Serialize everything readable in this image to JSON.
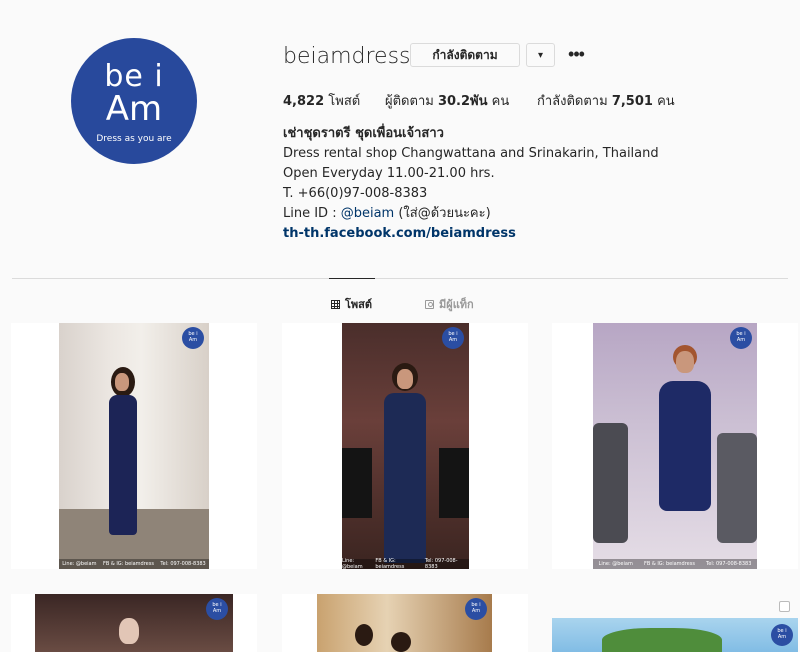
{
  "profile": {
    "avatar": {
      "line1": "be i",
      "line2": "Am",
      "tagline": "Dress as you are"
    },
    "username": "beiamdress",
    "follow_label": "กำลังติดตาม",
    "dropdown_icon": "▾",
    "more_icon": "•••",
    "stats": {
      "posts_value": "4,822",
      "posts_label": "โพสต์",
      "followers_label": "ผู้ติดตาม",
      "followers_value": "30.2พัน",
      "followers_unit": "คน",
      "following_label": "กำลังติดตาม",
      "following_value": "7,501",
      "following_unit": "คน"
    },
    "bio": {
      "name": "เช่าชุดราตรี ชุดเพื่อนเจ้าสาว",
      "line1": "Dress rental shop Changwattana and Srinakarin, Thailand",
      "line2": "Open Everyday 11.00-21.00 hrs.",
      "line3": "T. +66(0)97-008-8383",
      "line_prefix": "Line ID : ",
      "line_mention": "@beiam",
      "line_suffix": " (ใส่@ด้วยนะคะ)",
      "link": "th-th.facebook.com/beiamdress"
    }
  },
  "tabs": {
    "posts": "โพสต์",
    "tagged": "มีผู้แท็ก"
  },
  "watermark": {
    "line1": "be i",
    "line2": "Am"
  },
  "post_captions": {
    "p1": [
      "Line: @beiam",
      "FB & IG: beiamdress",
      "Tel: 097-008-8383"
    ],
    "p2": [
      "Line: @beiam",
      "FB & IG: beiamdress",
      "Tel: 097-008-8383"
    ],
    "p3": [
      "Line: @beiam",
      "FB & IG: beiamdress",
      "Tel: 097-008-8383"
    ]
  },
  "colors": {
    "brand_blue": "#28499c",
    "link": "#003569",
    "background": "#fafafa",
    "border": "#dbdbdb"
  }
}
